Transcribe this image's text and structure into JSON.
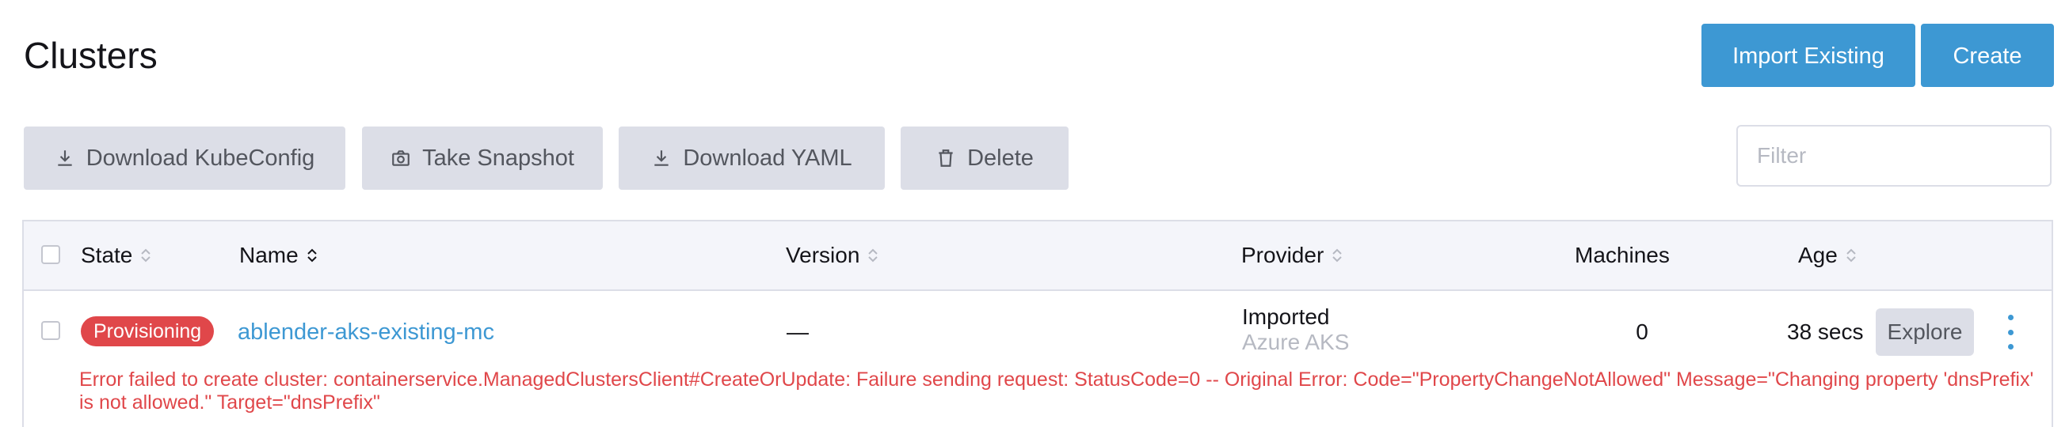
{
  "page": {
    "title": "Clusters"
  },
  "header_buttons": {
    "import_label": "Import Existing",
    "create_label": "Create"
  },
  "bulk_actions": {
    "download_kubeconfig": "Download KubeConfig",
    "take_snapshot": "Take Snapshot",
    "download_yaml": "Download YAML",
    "delete": "Delete"
  },
  "filter": {
    "placeholder": "Filter",
    "value": ""
  },
  "table": {
    "headers": {
      "state": "State",
      "name": "Name",
      "version": "Version",
      "provider": "Provider",
      "machines": "Machines",
      "age": "Age"
    },
    "rows": [
      {
        "state": "Provisioning",
        "name": "ablender-aks-existing-mc",
        "version": "—",
        "provider": "Imported",
        "provider_sub": "Azure AKS",
        "machines": "0",
        "age": "38 secs",
        "explore_label": "Explore",
        "error": "Error failed to create cluster: containerservice.ManagedClustersClient#CreateOrUpdate: Failure sending request: StatusCode=0 -- Original Error: Code=\"PropertyChangeNotAllowed\" Message=\"Changing property 'dnsPrefix' is not allowed.\" Target=\"dnsPrefix\""
      }
    ]
  },
  "colors": {
    "accent": "#3d98d3",
    "error": "#e0474a",
    "button_gray": "#dcdee7",
    "header_bg": "#f4f5fa"
  }
}
